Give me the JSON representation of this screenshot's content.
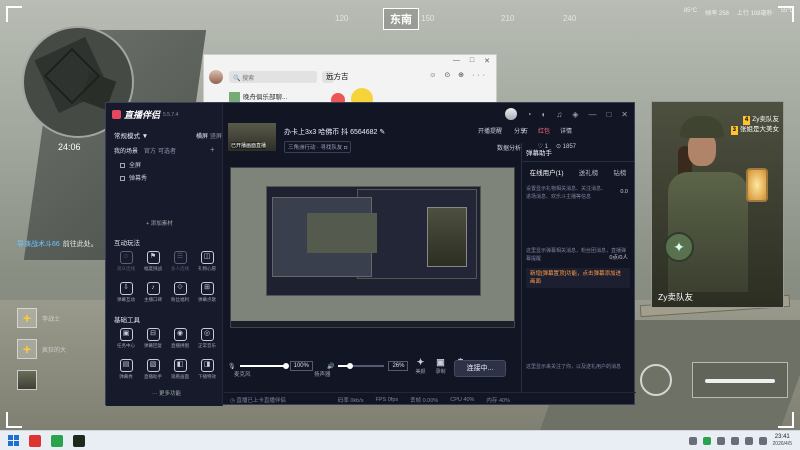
{
  "game": {
    "compass": {
      "ticks": [
        "120",
        "150",
        "210",
        "240"
      ],
      "direction": "东南"
    },
    "top_hud": [
      "85°C",
      "帧率 258",
      "上行 108毫秒",
      "55°C"
    ],
    "minimap_time": "24:06",
    "killfeed": {
      "name": "导演战术斗66",
      "action": "前往此处。"
    },
    "team": [
      {
        "slot": "+",
        "name": "李战士"
      },
      {
        "slot": "+",
        "name": "疯狂的大"
      },
      {
        "slot": "",
        "name": ""
      }
    ]
  },
  "char_card": {
    "tags": [
      {
        "badge": "4",
        "text": "Zy卖队友"
      },
      {
        "badge": "3",
        "text": "张姐是大美女"
      }
    ],
    "name": "Zy卖队友"
  },
  "chat_window": {
    "title": "远方吉",
    "search_placeholder": "搜索",
    "row": "晚舟俱乐部聊...",
    "controls": [
      "—",
      "□",
      "✕"
    ],
    "icons": "☺ ⊙ ⊕ ···"
  },
  "app": {
    "name": "直播伴侣",
    "version": "5.5.7.4",
    "side": {
      "mode": "常规模式 ▼",
      "mode_links": [
        "横屏",
        "竖屏"
      ],
      "my_scenes": "我的场景",
      "scene_links": [
        "官方",
        "可选者"
      ],
      "scenes": [
        "全屏",
        "弹幕秀"
      ],
      "add_scene": "+ 添加素材",
      "interactive_title": "互动玩法",
      "interactive_tools": [
        {
          "icon": "☺",
          "label": "观众连线",
          "dim": true
        },
        {
          "icon": "⚑",
          "label": "幅度挑战",
          "dim": false
        },
        {
          "icon": "☰",
          "label": "多人连线",
          "dim": true
        },
        {
          "icon": "◫",
          "label": "礼物心愿",
          "dim": false
        },
        {
          "icon": "⇩",
          "label": "弹幕互动",
          "dim": false
        },
        {
          "icon": "♪",
          "label": "主播口碑",
          "dim": false
        },
        {
          "icon": "⟐",
          "label": "粉丝福利",
          "dim": false
        },
        {
          "icon": "⊞",
          "label": "弹幕点歌",
          "dim": false
        }
      ],
      "basic_title": "基础工具",
      "basic_tools": [
        {
          "icon": "▣",
          "label": "任务中心",
          "dim": false
        },
        {
          "icon": "⊟",
          "label": "弹幕回复",
          "dim": false
        },
        {
          "icon": "◉",
          "label": "直播拼图",
          "dim": false
        },
        {
          "icon": "◎",
          "label": "正常音乐",
          "dim": false
        },
        {
          "icon": "▤",
          "label": "弹幕秀",
          "dim": false
        },
        {
          "icon": "▧",
          "label": "直播助手",
          "dim": false
        },
        {
          "icon": "◧",
          "label": "观看画面",
          "dim": false
        },
        {
          "icon": "◨",
          "label": "下播特效",
          "dim": false
        }
      ],
      "more": "··· 更多功能"
    },
    "top_icons": [
      "◔",
      "◐",
      "♫",
      "◈",
      "—",
      "□",
      "✕"
    ],
    "stream": {
      "thumb_tag": "已开播画面直播",
      "title": "办卡上3x3 哈佛币 抖 6564682 ✎",
      "category": "三角洲行动 · 寻找队友 ◘",
      "buttons": [
        "开播提醒",
        "分享"
      ],
      "extras": [
        "万",
        "红包",
        "详情"
      ],
      "stats": [
        "♡ 1",
        "⊙ 1857"
      ],
      "data_label": "数据分析"
    },
    "assist": {
      "head": "弹幕助手",
      "tabs": [
        "在线用户(1)",
        "送礼榜",
        "钻榜"
      ],
      "desc1": "设置显示礼物相关消息、关注消息、进场消息、欢乐斗主播等信息",
      "count1": "0.0",
      "desc2": "这里显示弹幕相关消息，粉丝团消息，直播弹幕提醒",
      "warn": "新增[弹幕置顶]功能，点击弹幕添加进画面",
      "count2": "0点/0人",
      "foot": "这里显示来关注了你，以及送礼用户的消息"
    },
    "controls": {
      "mic_label": "麦克风",
      "mic_pct": "100%",
      "speaker_label": "扬声器",
      "speaker_pct": "26%",
      "mic_level": 1.0,
      "speaker_level": 0.26,
      "icons": [
        {
          "icon": "✦",
          "label": "美颜"
        },
        {
          "icon": "▣",
          "label": "录制"
        },
        {
          "icon": "⚙",
          "label": "设置"
        }
      ],
      "live_button": "连接中..."
    },
    "status": [
      "◷ 直播已上卡直播伴侣",
      "码率 0kb/s",
      "FPS 0fps",
      "丢帧 0.00%",
      "CPU 40%",
      "内存 40%"
    ]
  },
  "taskbar": {
    "time": "23:41",
    "date": "2026/4/5"
  }
}
